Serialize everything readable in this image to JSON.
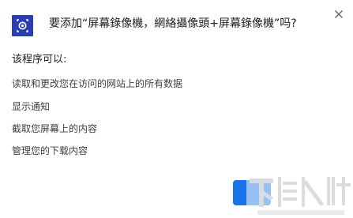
{
  "dialog": {
    "title": "要添加“屏幕錄像機，網絡攝像頭+屏幕錄像機”吗?",
    "subtitle": "该程序可以:",
    "permissions": [
      "读取和更改您在访问的网站上的所有数据",
      "显示通知",
      "截取您屏幕上的内容",
      "管理您的下载内容"
    ]
  },
  "icons": {
    "app": "screen-recorder-app-icon",
    "close": "close-icon"
  },
  "colors": {
    "app_icon_bg": "#2a3db4",
    "button_blue": "#1a73e8",
    "text": "#202124",
    "secondary_text": "#3c4043"
  }
}
